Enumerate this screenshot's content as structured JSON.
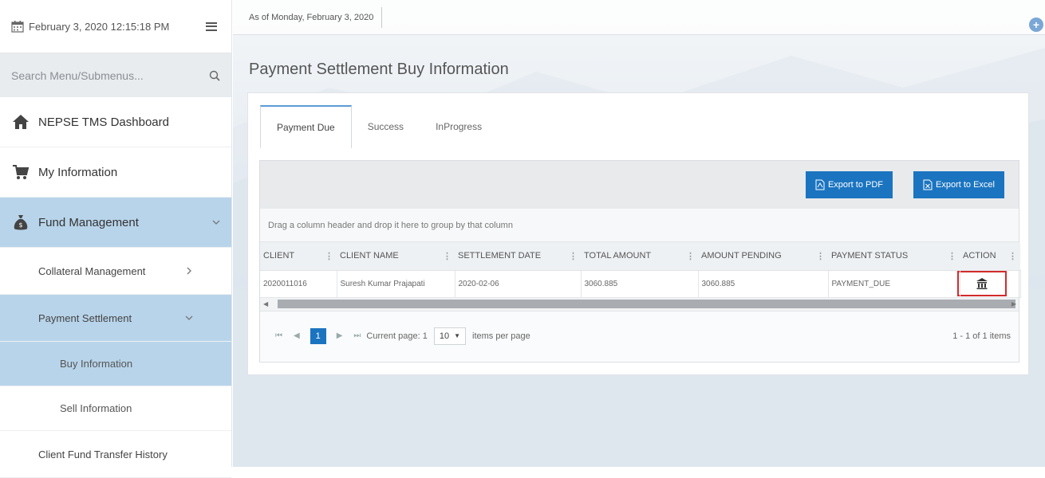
{
  "sidebar": {
    "datetime": "February 3, 2020 12:15:18 PM",
    "search_placeholder": "Search Menu/Submenus...",
    "items": [
      {
        "label": "NEPSE TMS Dashboard",
        "icon": "home-icon"
      },
      {
        "label": "My Information",
        "icon": "cart-icon"
      },
      {
        "label": "Fund Management",
        "icon": "money-bag-icon"
      }
    ],
    "fund_submenu": [
      {
        "label": "Collateral Management"
      },
      {
        "label": "Payment Settlement"
      }
    ],
    "payment_submenu": [
      {
        "label": "Buy Information"
      },
      {
        "label": "Sell Information"
      }
    ],
    "client_transfer": "Client Fund Transfer History"
  },
  "topbar": {
    "as_of": "As of Monday, February 3, 2020",
    "plus": "+"
  },
  "page": {
    "title": "Payment Settlement Buy Information"
  },
  "tabs": [
    {
      "label": "Payment Due",
      "active": true
    },
    {
      "label": "Success",
      "active": false
    },
    {
      "label": "InProgress",
      "active": false
    }
  ],
  "toolbar": {
    "export_pdf": "Export to PDF",
    "export_excel": "Export to Excel"
  },
  "grid": {
    "group_hint": "Drag a column header and drop it here to group by that column",
    "columns": [
      "CLIENT",
      "CLIENT NAME",
      "SETTLEMENT DATE",
      "TOTAL AMOUNT",
      "AMOUNT PENDING",
      "PAYMENT STATUS",
      "ACTION"
    ],
    "rows": [
      {
        "client": "2020011016",
        "client_name": "Suresh Kumar Prajapati",
        "settlement_date": "2020-02-06",
        "total_amount": "3060.885",
        "amount_pending": "3060.885",
        "payment_status": "PAYMENT_DUE",
        "action_icon": "bank-icon"
      }
    ]
  },
  "pager": {
    "page": "1",
    "current_page_label": "Current page: 1",
    "per_page": "10",
    "per_page_label": "items per page",
    "info": "1 - 1 of 1 items"
  },
  "colors": {
    "accent": "#1b74c0",
    "active_bg": "#b8d4ea",
    "highlight": "#d22b2b"
  }
}
